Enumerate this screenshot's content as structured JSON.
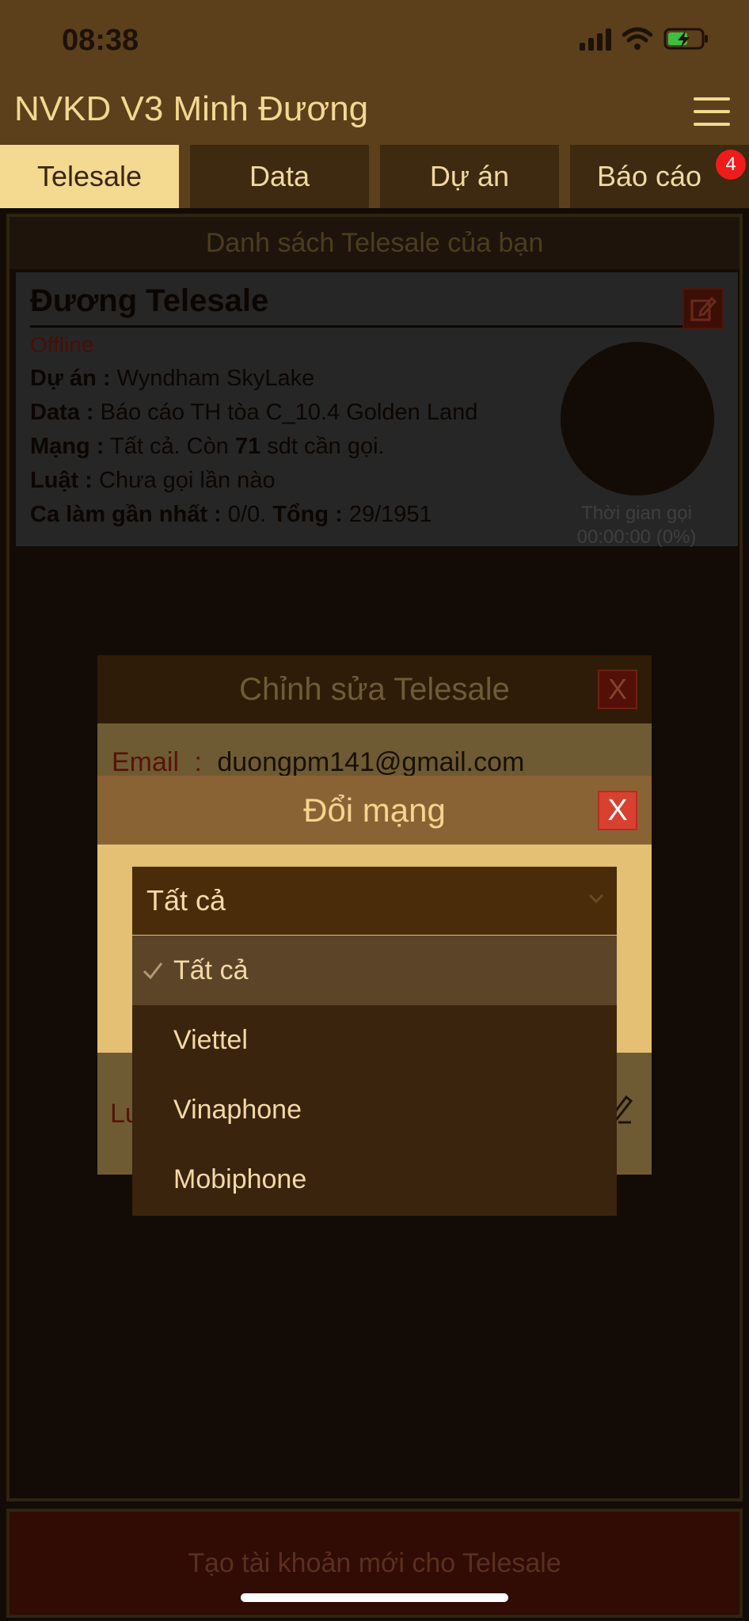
{
  "status_bar": {
    "time": "08:38"
  },
  "app": {
    "title": "NVKD V3 Minh Đương"
  },
  "tabs": [
    {
      "label": "Telesale",
      "active": true
    },
    {
      "label": "Data",
      "active": false
    },
    {
      "label": "Dự án",
      "active": false
    },
    {
      "label": "Báo cáo",
      "active": false,
      "badge": "4"
    }
  ],
  "list": {
    "header": "Danh sách Telesale của bạn",
    "card": {
      "name": "Đương Telesale",
      "status": "Offline",
      "project_label": "Dự án :",
      "project_value": "Wyndham SkyLake",
      "data_label": "Data :",
      "data_value": "Báo cáo TH tòa C_10.4 Golden Land",
      "network_label": "Mạng :",
      "network_value": "Tất cả. Còn",
      "network_count": "71",
      "network_suffix": "sdt cần gọi.",
      "rule_label": "Luật :",
      "rule_value": "Chưa gọi lần nào",
      "shift_label": "Ca làm gần nhất :",
      "shift_value": "0/0.",
      "total_label": "Tổng :",
      "total_value": "29/1951",
      "call_time_label": "Thời gian gọi",
      "call_time_value": "00:00:00 (0%)"
    }
  },
  "create_button": "Tạo tài khoản mới cho Telesale",
  "edit_dialog": {
    "title": "Chỉnh sửa Telesale",
    "close": "X",
    "email_label": "Email",
    "email_sep": ":",
    "email_value": "duongpm141@gmail.com",
    "partial_label": "Lu"
  },
  "network_dialog": {
    "title": "Đổi mạng",
    "close": "X",
    "selected": "Tất cả",
    "options": [
      "Tất cả",
      "Viettel",
      "Vinaphone",
      "Mobiphone"
    ]
  },
  "colors": {
    "header_bg": "#5c401b",
    "tab_active": "#f4d991",
    "accent_gold": "#f3d893",
    "close_red": "#d84030"
  }
}
